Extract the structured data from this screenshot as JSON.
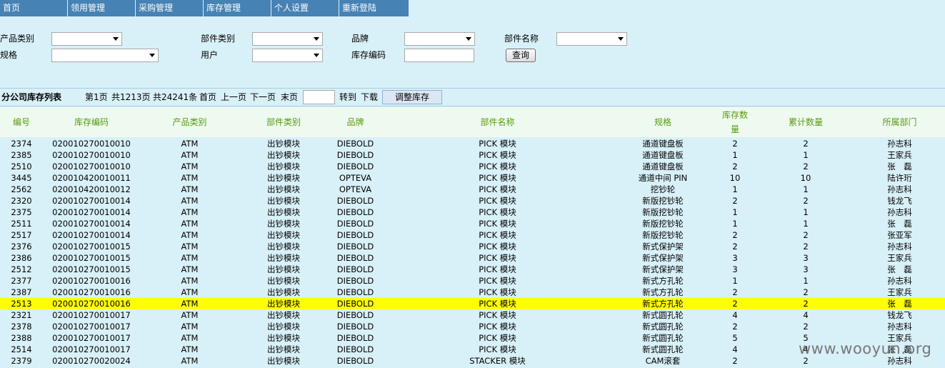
{
  "nav": [
    "首页",
    "领用管理",
    "采购管理",
    "库存管理",
    "个人设置",
    "重新登陆"
  ],
  "filters": {
    "product_category": "产品类别",
    "part_category": "部件类别",
    "brand": "品牌",
    "part_name": "部件名称",
    "spec": "规格",
    "user": "用户",
    "stock_code": "库存编码",
    "query_button": "查询"
  },
  "listbar": {
    "title": "分公司库存列表",
    "page": "第1页",
    "total_pages": "共1213页",
    "total_records": "共24241条",
    "first": "首页",
    "prev": "上一页",
    "next": "下一页",
    "last": "末页",
    "goto": "转到",
    "download": "下载",
    "adjust_button": "调整库存"
  },
  "table": {
    "headers": [
      "编号",
      "库存编码",
      "产品类别",
      "部件类别",
      "品牌",
      "部件名称",
      "规格",
      "库存数量",
      "累计数量",
      "所属部门"
    ],
    "highlight_row": 14,
    "rows": [
      [
        "2374",
        "020010270010010",
        "ATM",
        "出钞模块",
        "DIEBOLD",
        "PICK 模块",
        "通道键盘板",
        "2",
        "2",
        "孙志科"
      ],
      [
        "2385",
        "020010270010010",
        "ATM",
        "出钞模块",
        "DIEBOLD",
        "PICK 模块",
        "通道键盘板",
        "1",
        "1",
        "王家兵"
      ],
      [
        "2510",
        "020010270010010",
        "ATM",
        "出钞模块",
        "DIEBOLD",
        "PICK 模块",
        "通道键盘板",
        "2",
        "2",
        "张　磊"
      ],
      [
        "3445",
        "020010420010011",
        "ATM",
        "出钞模块",
        "OPTEVA",
        "PICK 模块",
        "通道中间 PIN",
        "10",
        "10",
        "陆许珩"
      ],
      [
        "2562",
        "020010420010012",
        "ATM",
        "出钞模块",
        "OPTEVA",
        "PICK 模块",
        "挖钞轮",
        "1",
        "1",
        "孙志科"
      ],
      [
        "2320",
        "020010270010014",
        "ATM",
        "出钞模块",
        "DIEBOLD",
        "PICK 模块",
        "新版挖钞轮",
        "2",
        "2",
        "钱龙飞"
      ],
      [
        "2375",
        "020010270010014",
        "ATM",
        "出钞模块",
        "DIEBOLD",
        "PICK 模块",
        "新版挖钞轮",
        "1",
        "1",
        "孙志科"
      ],
      [
        "2511",
        "020010270010014",
        "ATM",
        "出钞模块",
        "DIEBOLD",
        "PICK 模块",
        "新版挖钞轮",
        "1",
        "1",
        "张　磊"
      ],
      [
        "2517",
        "020010270010014",
        "ATM",
        "出钞模块",
        "DIEBOLD",
        "PICK 模块",
        "新版挖钞轮",
        "2",
        "2",
        "张亚军"
      ],
      [
        "2376",
        "020010270010015",
        "ATM",
        "出钞模块",
        "DIEBOLD",
        "PICK 模块",
        "新式保护架",
        "2",
        "2",
        "孙志科"
      ],
      [
        "2386",
        "020010270010015",
        "ATM",
        "出钞模块",
        "DIEBOLD",
        "PICK 模块",
        "新式保护架",
        "3",
        "3",
        "王家兵"
      ],
      [
        "2512",
        "020010270010015",
        "ATM",
        "出钞模块",
        "DIEBOLD",
        "PICK 模块",
        "新式保护架",
        "3",
        "3",
        "张　磊"
      ],
      [
        "2377",
        "020010270010016",
        "ATM",
        "出钞模块",
        "DIEBOLD",
        "PICK 模块",
        "新式方孔轮",
        "1",
        "1",
        "孙志科"
      ],
      [
        "2387",
        "020010270010016",
        "ATM",
        "出钞模块",
        "DIEBOLD",
        "PICK 模块",
        "新式方孔轮",
        "2",
        "2",
        "王家兵"
      ],
      [
        "2513",
        "020010270010016",
        "ATM",
        "出钞模块",
        "DIEBOLD",
        "PICK 模块",
        "新式方孔轮",
        "2",
        "2",
        "张　磊"
      ],
      [
        "2321",
        "020010270010017",
        "ATM",
        "出钞模块",
        "DIEBOLD",
        "PICK 模块",
        "新式圆孔轮",
        "4",
        "4",
        "钱龙飞"
      ],
      [
        "2378",
        "020010270010017",
        "ATM",
        "出钞模块",
        "DIEBOLD",
        "PICK 模块",
        "新式圆孔轮",
        "2",
        "2",
        "孙志科"
      ],
      [
        "2388",
        "020010270010017",
        "ATM",
        "出钞模块",
        "DIEBOLD",
        "PICK 模块",
        "新式圆孔轮",
        "5",
        "5",
        "王家兵"
      ],
      [
        "2514",
        "020010270010017",
        "ATM",
        "出钞模块",
        "DIEBOLD",
        "PICK 模块",
        "新式圆孔轮",
        "4",
        "4",
        "张　磊"
      ],
      [
        "2379",
        "020010270020024",
        "ATM",
        "出钞模块",
        "DIEBOLD",
        "STACKER 模块",
        "CAM滚套",
        "2",
        "2",
        "孙志科"
      ]
    ]
  },
  "watermark": "www.wooyun.org"
}
